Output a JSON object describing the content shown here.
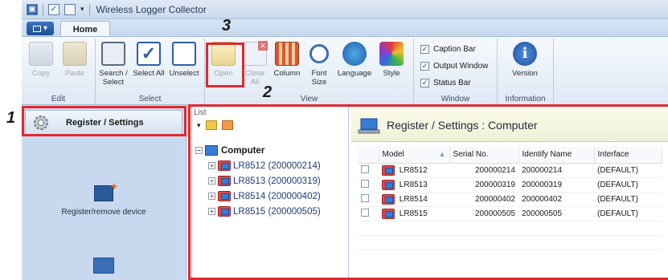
{
  "window": {
    "title": "Wireless Logger Collector",
    "quick_access": [
      "app-icon",
      "check-icon",
      "square-icon",
      "dropdown-icon"
    ]
  },
  "ribbon": {
    "app_menu_glyph": "▾",
    "tabs": [
      {
        "label": "Home",
        "active": true
      }
    ],
    "groups": {
      "edit": {
        "label": "Edit",
        "copy": "Copy",
        "paste": "Paste"
      },
      "select": {
        "label": "Select",
        "search": "Search / Select",
        "select_all": "Select All",
        "unselect": "Unselect"
      },
      "view": {
        "label": "View",
        "open": "Open",
        "close": "Close All",
        "column": "Column",
        "font_size": "Font Size",
        "language": "Language",
        "style": "Style"
      },
      "window": {
        "label": "Window",
        "caption_bar": "Caption Bar",
        "output_window": "Output Window",
        "status_bar": "Status Bar"
      },
      "information": {
        "label": "Information",
        "version": "Version"
      }
    }
  },
  "nav": {
    "header_label": "Register / Settings",
    "items": [
      {
        "label": "Register/remove device",
        "icon": "device-add-icon"
      },
      {
        "label": "",
        "icon": "settings-device-icon"
      }
    ]
  },
  "tree": {
    "title": "List",
    "root": "Computer",
    "nodes": [
      {
        "label": "LR8512 (200000214)"
      },
      {
        "label": "LR8513 (200000319)"
      },
      {
        "label": "LR8514 (200000402)"
      },
      {
        "label": "LR8515 (200000505)"
      }
    ]
  },
  "content": {
    "title": "Register / Settings : Computer",
    "columns": [
      "Model",
      "Serial No.",
      "Identify Name",
      "Interface"
    ],
    "rows": [
      {
        "model": "LR8512",
        "serial": "200000214",
        "name": "200000214",
        "interface": "(DEFAULT)"
      },
      {
        "model": "LR8513",
        "serial": "200000319",
        "name": "200000319",
        "interface": "(DEFAULT)"
      },
      {
        "model": "LR8514",
        "serial": "200000402",
        "name": "200000402",
        "interface": "(DEFAULT)"
      },
      {
        "model": "LR8515",
        "serial": "200000505",
        "name": "200000505",
        "interface": "(DEFAULT)"
      }
    ]
  },
  "annotations": {
    "callout_1": "1",
    "callout_2": "2",
    "callout_3": "3"
  },
  "colors": {
    "annotation_red": "#e0282e",
    "nav_bg": "#cbdbf1",
    "header_bg": "#fbfbe8"
  }
}
